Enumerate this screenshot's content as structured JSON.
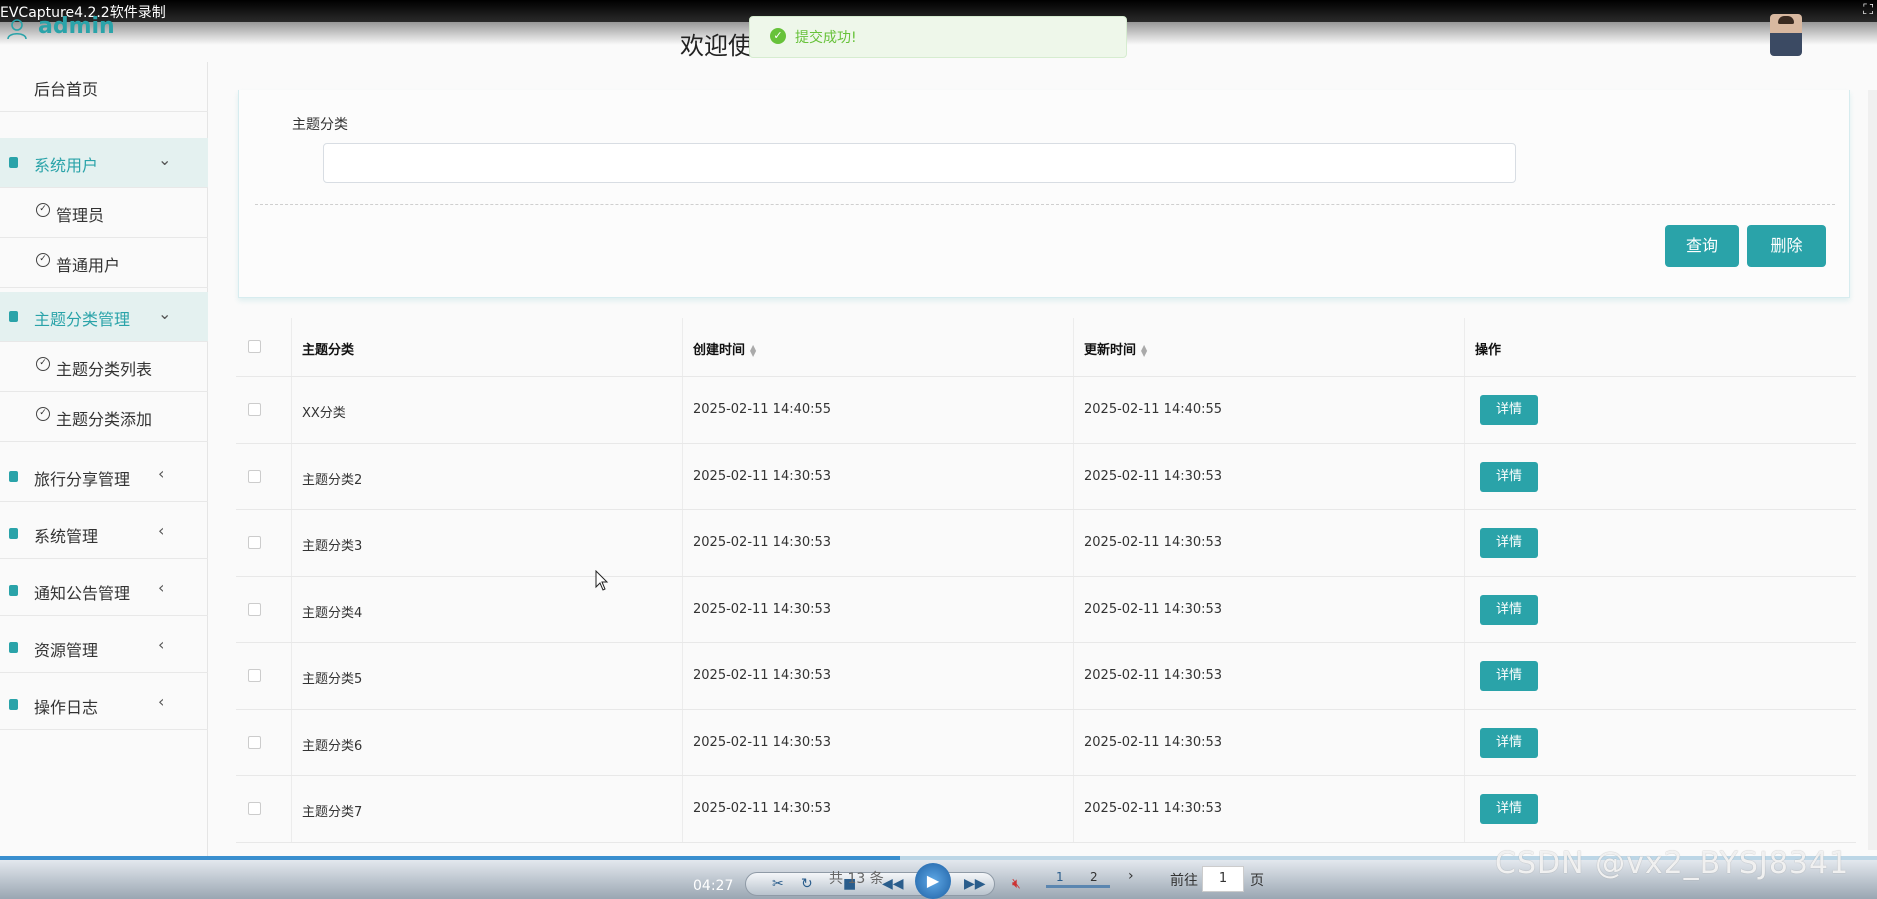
{
  "recorder": {
    "title": "EVCapture4.2.2软件录制"
  },
  "header": {
    "app_name": "admin",
    "welcome": "欢迎使",
    "toast": "提交成功!"
  },
  "sidebar": {
    "home": "后台首页",
    "system_users": "系统用户",
    "admin": "管理员",
    "normal_user": "普通用户",
    "topic_mgmt": "主题分类管理",
    "topic_list": "主题分类列表",
    "topic_add": "主题分类添加",
    "travel_share": "旅行分享管理",
    "system_mgmt": "系统管理",
    "notice_mgmt": "通知公告管理",
    "resource_mgmt": "资源管理",
    "op_log": "操作日志"
  },
  "search": {
    "label": "主题分类",
    "query_btn": "查询",
    "delete_btn": "删除"
  },
  "table": {
    "headers": {
      "category": "主题分类",
      "created": "创建时间",
      "updated": "更新时间",
      "action": "操作"
    },
    "detail_btn": "详情",
    "rows": [
      {
        "category": "XX分类",
        "created": "2025-02-11 14:40:55",
        "updated": "2025-02-11 14:40:55"
      },
      {
        "category": "主题分类2",
        "created": "2025-02-11 14:30:53",
        "updated": "2025-02-11 14:30:53"
      },
      {
        "category": "主题分类3",
        "created": "2025-02-11 14:30:53",
        "updated": "2025-02-11 14:30:53"
      },
      {
        "category": "主题分类4",
        "created": "2025-02-11 14:30:53",
        "updated": "2025-02-11 14:30:53"
      },
      {
        "category": "主题分类5",
        "created": "2025-02-11 14:30:53",
        "updated": "2025-02-11 14:30:53"
      },
      {
        "category": "主题分类6",
        "created": "2025-02-11 14:30:53",
        "updated": "2025-02-11 14:30:53"
      },
      {
        "category": "主题分类7",
        "created": "2025-02-11 14:30:53",
        "updated": "2025-02-11 14:30:53"
      }
    ]
  },
  "pagination": {
    "total": "共 13 条",
    "page1": "1",
    "page2": "2",
    "goto": "前往",
    "goto_value": "1",
    "page_unit": "页"
  },
  "player": {
    "time": "04:27"
  },
  "watermark": "CSDN @vx2_BYSJ8341"
}
